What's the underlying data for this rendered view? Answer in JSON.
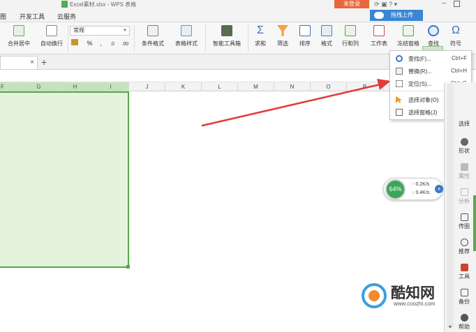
{
  "window": {
    "title": "Excel素材.xlsx - WPS 表格",
    "login_label": "未登录",
    "upload_label": "拖拽上传"
  },
  "menu": {
    "items": [
      "图",
      "开发工具",
      "云服务"
    ]
  },
  "ribbon": {
    "merge_label": "合并居中",
    "wrap_label": "自动换行",
    "number_format": "常规",
    "percent": "%",
    "comma": ",",
    "dec_inc": ".0",
    "dec_dec": ".00",
    "cond_format_label": "条件格式",
    "table_style_label": "表格样式",
    "toolbox_label": "智能工具箱",
    "sum_label": "求和",
    "filter_label": "筛选",
    "sort_label": "排序",
    "format_label": "格式",
    "rowcol_label": "行和列",
    "sheet_label": "工作表",
    "freeze_label": "冻结窗格",
    "find_label": "查找",
    "symbol_label": "符号"
  },
  "tabs": {
    "close_glyph": "×",
    "add_glyph": "+"
  },
  "grid": {
    "columns": [
      "F",
      "G",
      "H",
      "I",
      "J",
      "K",
      "L",
      "M",
      "N",
      "O",
      "P"
    ]
  },
  "dropdown": {
    "items": [
      {
        "label": "查找(F)...",
        "shortcut": "Ctrl+F",
        "icon": "search-icon"
      },
      {
        "label": "替换(R)...",
        "shortcut": "Ctrl+H",
        "icon": "replace-icon"
      },
      {
        "label": "定位(S)...",
        "shortcut": "Ctrl+G",
        "icon": "locate-icon"
      },
      {
        "label": "选择对象(O)",
        "shortcut": "",
        "icon": "select-object-icon"
      },
      {
        "label": "选择窗格(J)",
        "shortcut": "",
        "icon": "selection-pane-icon"
      }
    ]
  },
  "network": {
    "percent": "64%",
    "up": "0.2K/s",
    "down": "0.4K/s",
    "plus": "+"
  },
  "sidebar": {
    "items": [
      {
        "label": "选择",
        "dim": false
      },
      {
        "label": "形状",
        "dim": false
      },
      {
        "label": "属性",
        "dim": true
      },
      {
        "label": "分析",
        "dim": true
      },
      {
        "label": "传图",
        "dim": false
      },
      {
        "label": "推荐",
        "dim": false
      },
      {
        "label": "工具",
        "dim": false
      },
      {
        "label": "备份",
        "dim": false
      },
      {
        "label": "帮助",
        "dim": false
      }
    ]
  },
  "watermark": {
    "brand": "酷知网",
    "url": "www.coozhi.com"
  },
  "colors": {
    "accent_green": "#57a84a",
    "selection_fill": "#e4f3de",
    "arrow_red": "#e23b3b",
    "login_orange": "#e8673c",
    "upload_blue": "#3a86d4"
  }
}
